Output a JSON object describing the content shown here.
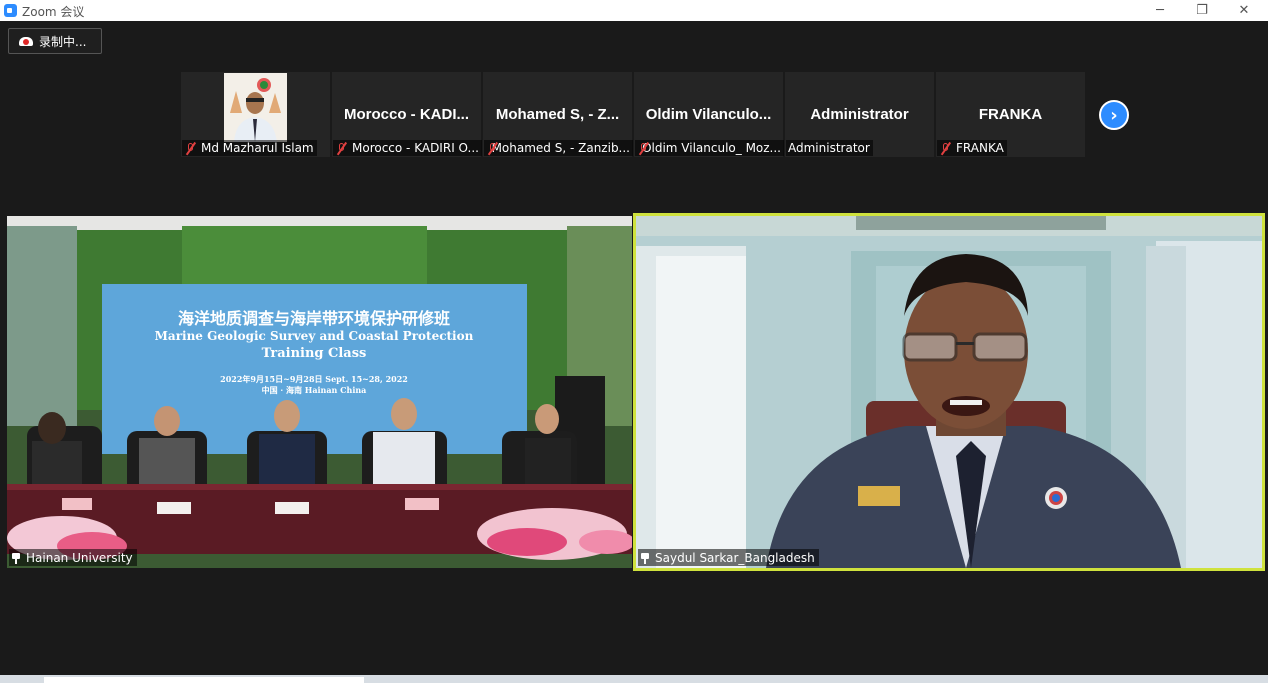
{
  "window": {
    "title": "Zoom 会议",
    "minimize_glyph": "─",
    "maximize_glyph": "❐",
    "close_glyph": "✕"
  },
  "recording": {
    "label": "录制中..."
  },
  "thumbnails": [
    {
      "display": "",
      "tag": "Md Mazharul Islam",
      "muted": true,
      "has_video": true
    },
    {
      "display": "Morocco - KADI...",
      "tag": "Morocco - KADIRI O...",
      "muted": true
    },
    {
      "display": "Mohamed S, - Z...",
      "tag": "Mohamed S, - Zanzib...",
      "muted": true
    },
    {
      "display": "Oldim Vilanculo...",
      "tag": "Oldim Vilanculo_ Moz...",
      "muted": true
    },
    {
      "display": "Administrator",
      "tag": "Administrator",
      "muted": false
    },
    {
      "display": "FRANKA",
      "tag": "FRANKA",
      "muted": true
    }
  ],
  "next_glyph": "›",
  "main": {
    "left": {
      "name": "Hainan University",
      "banner": {
        "cn_title": "海洋地质调查与海岸带环境保护研修班",
        "en_line1": "Marine Geologic Survey and Coastal Protection",
        "en_line2": "Training Class",
        "dates": "2022年9月15日~9月28日  Sept. 15~28, 2022",
        "place": "中国 · 海南  Hainan China"
      }
    },
    "right": {
      "name": "Saydul Sarkar_Bangladesh"
    }
  },
  "colors": {
    "zoom_blue": "#2d8cff",
    "active_speaker_border": "#cfe23d",
    "muted_red": "#e04040"
  }
}
